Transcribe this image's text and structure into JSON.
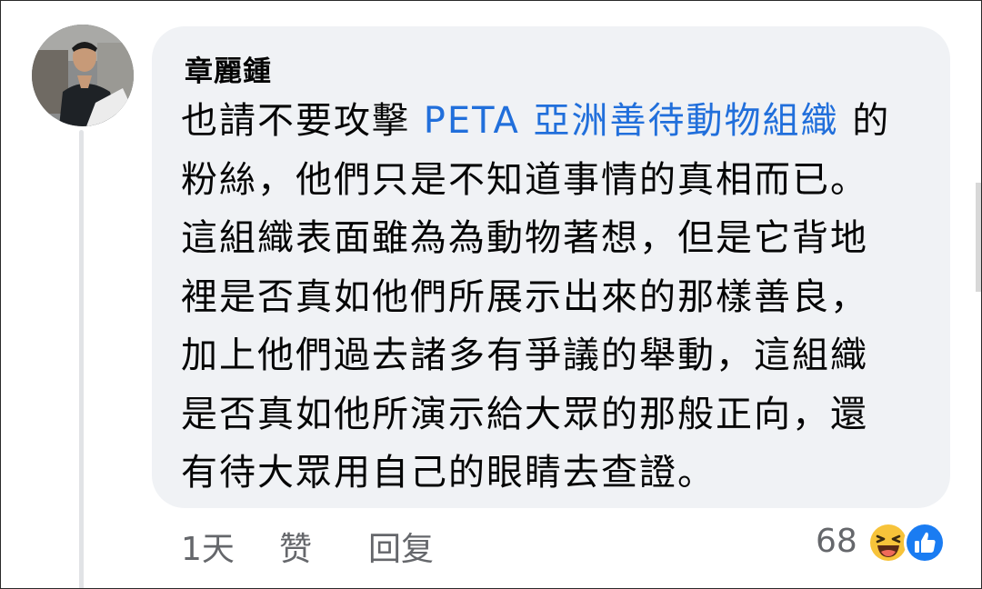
{
  "comment": {
    "author": "章麗鍾",
    "lines": {
      "l1_before": "也請不要攻擊 ",
      "l1_tag": "PETA 亞洲善待動物組織",
      "l1_after": " 的",
      "l2": "粉絲，他們只是不知道事情的真相而已。",
      "l3": "這組織表面雖為為動物著想，但是它背地",
      "l4": "裡是否真如他們所展示出來的那樣善良，",
      "l5": "加上他們過去諸多有爭議的舉動，這組織",
      "l6": "是否真如他所演示給大眾的那般正向，還",
      "l7": "有待大眾用自己的眼睛去查證。"
    },
    "tag_color": "#216fdb"
  },
  "actions": {
    "time": "1天",
    "like_label": "赞",
    "reply_label": "回复"
  },
  "reactions": {
    "count": "68",
    "icons": [
      "haha-icon",
      "like-thumb-icon"
    ]
  }
}
